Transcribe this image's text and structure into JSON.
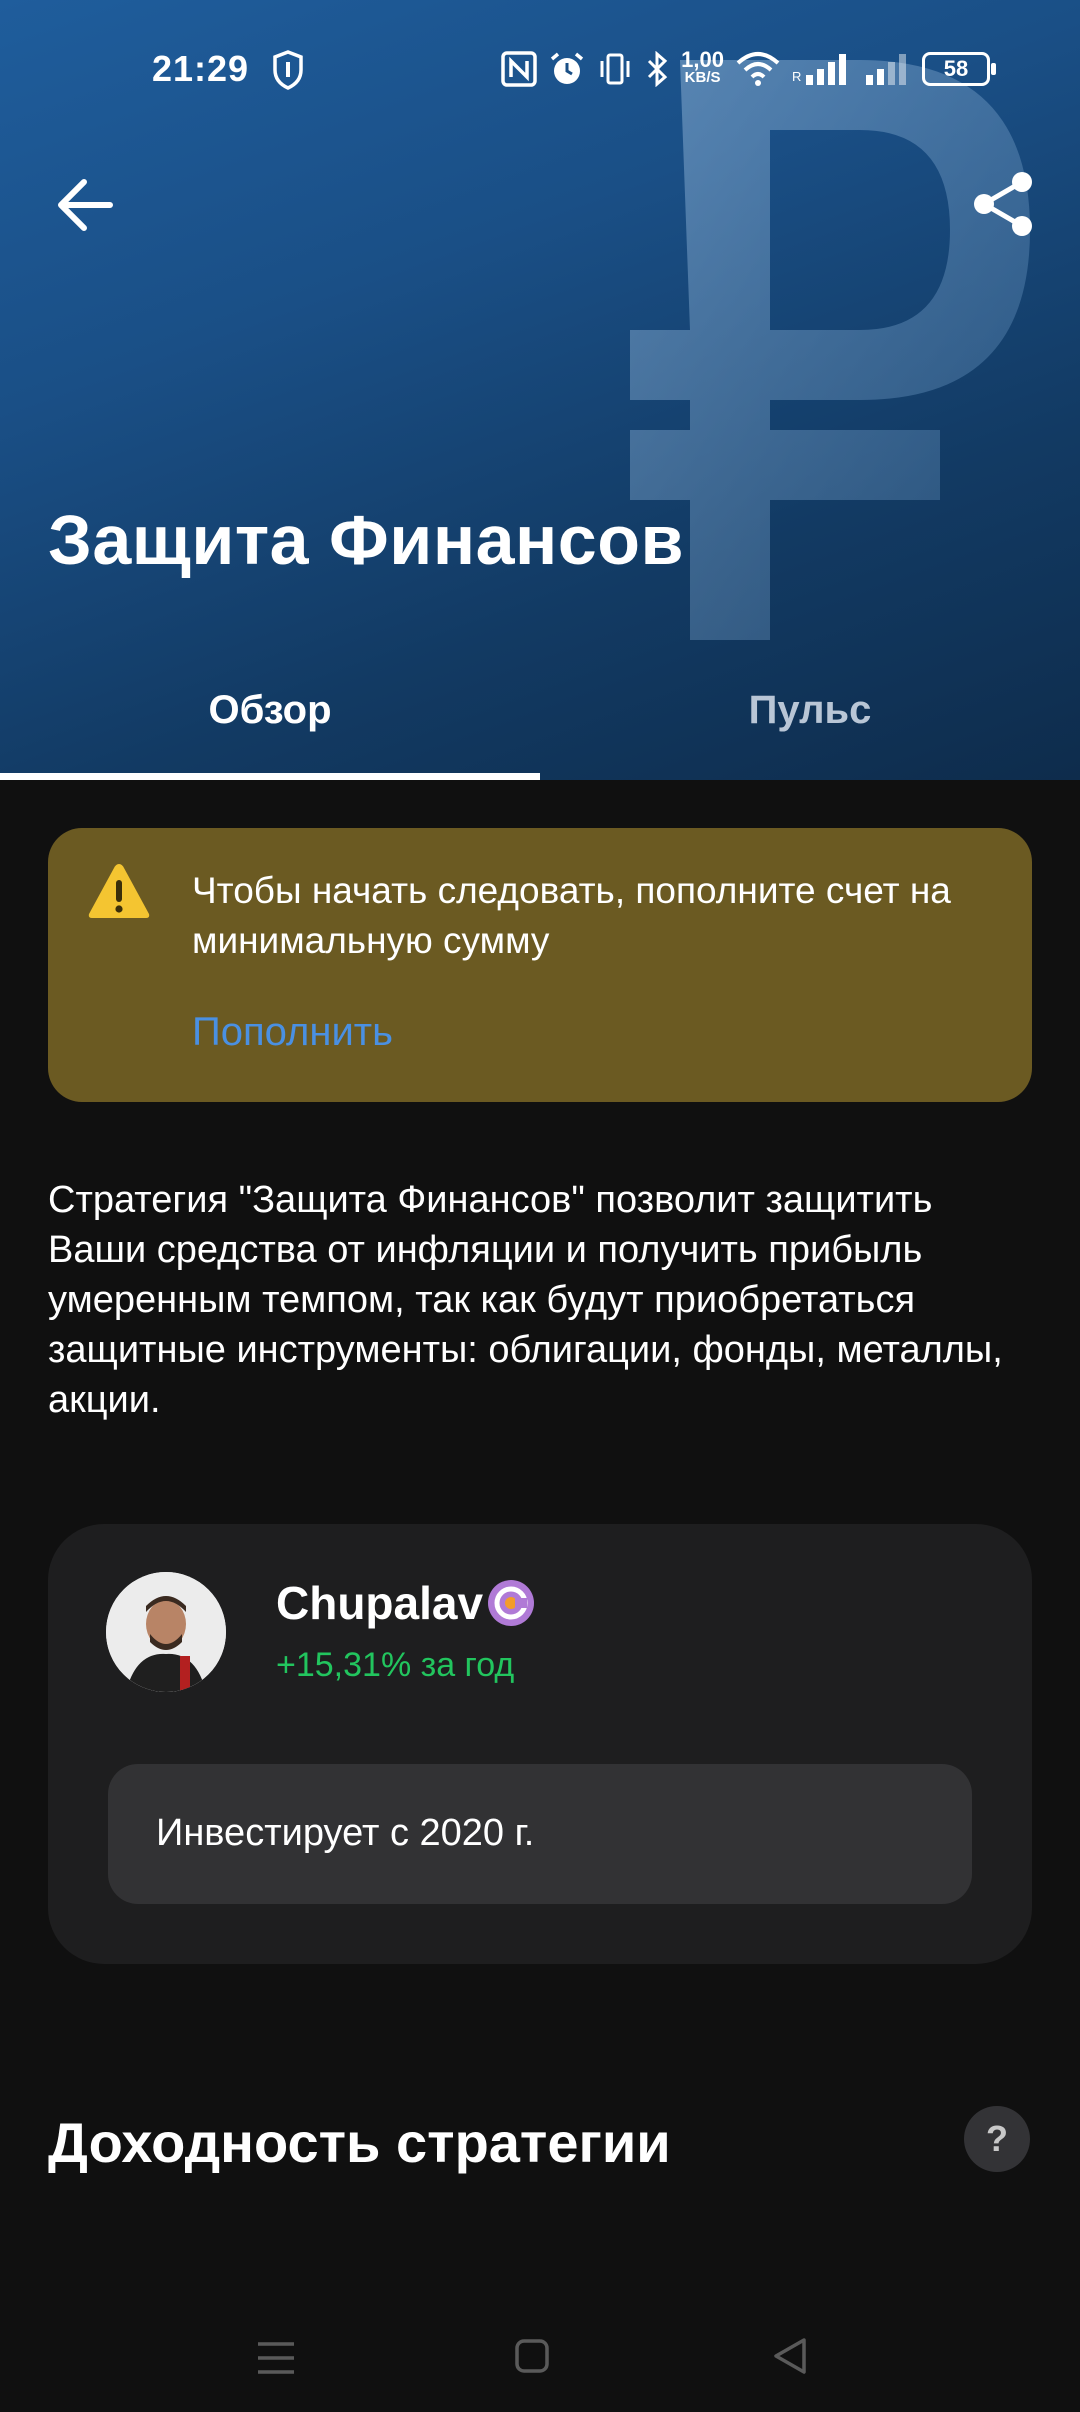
{
  "status_bar": {
    "time": "21:29",
    "speed_value": "1,00",
    "speed_unit": "KB/S",
    "battery": "58"
  },
  "header": {
    "title": "Защита Финансов"
  },
  "tabs": [
    {
      "label": "Обзор",
      "active": true
    },
    {
      "label": "Пульс",
      "active": false
    }
  ],
  "warning": {
    "message": "Чтобы начать следовать, пополните счет на минимальную сумму",
    "action": "Пополнить"
  },
  "description": "Стратегия \"Защита Финансов\" позволит защитить Ваши средства от инфляции и получить прибыль умеренным темпом, так как будут приобретаться защитные инструменты: облигации, фонды, металлы, акции.",
  "author": {
    "name": "Chupalav",
    "return": "+15,31% за год",
    "investing_since": "Инвестирует с 2020 г."
  },
  "section": {
    "title": "Доходность стратегии",
    "help": "?"
  },
  "colors": {
    "hero_blue": "#1a4f86",
    "warning_bg": "#6b5a22",
    "link_blue": "#4a90e2",
    "positive_green": "#22c55e",
    "page_bg": "#101010"
  },
  "icons": {
    "back": "arrow-left-icon",
    "share": "share-icon",
    "warning": "warning-triangle-icon",
    "verified": "verified-badge-icon",
    "help": "question-icon"
  }
}
